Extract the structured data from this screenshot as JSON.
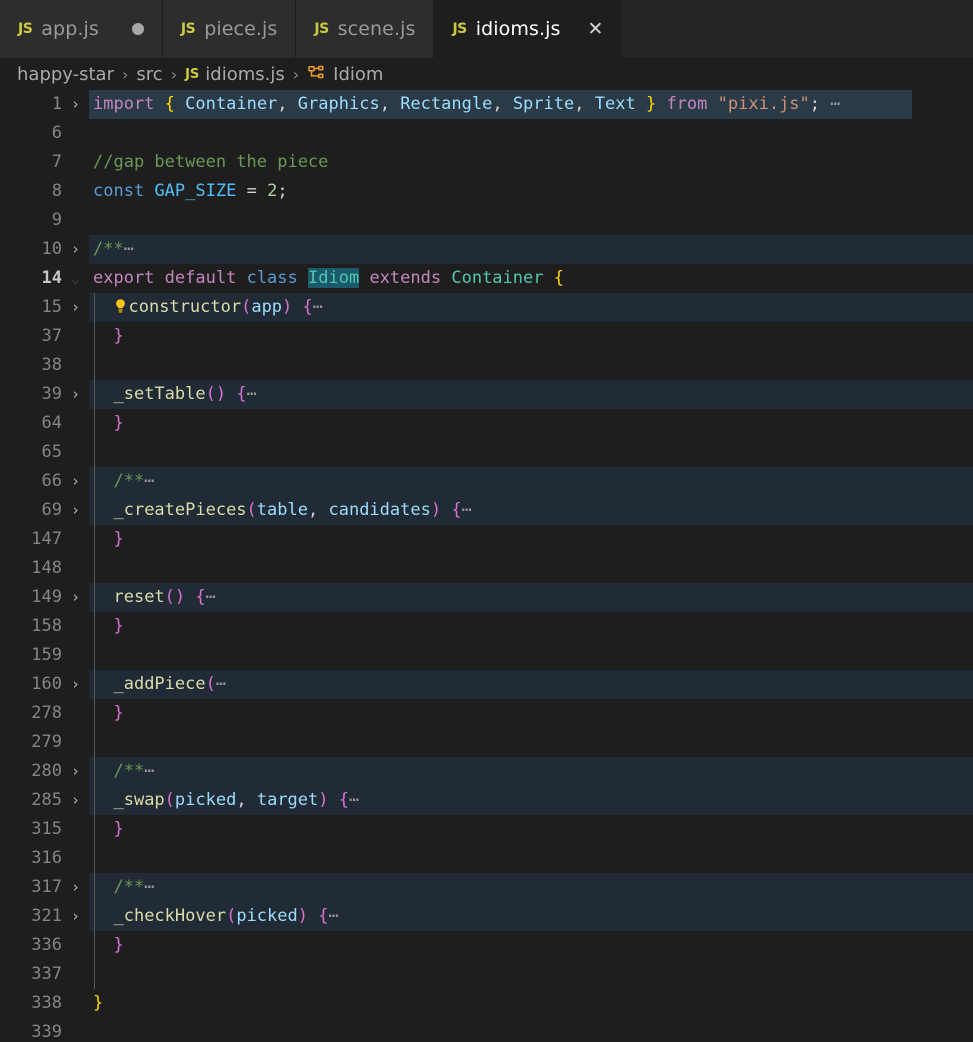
{
  "window": {
    "app": "vscode",
    "colors": {
      "editor_bg": "#1e1e1e",
      "tabbar_bg": "#252526",
      "tab_inactive_bg": "#2d2d2d",
      "folded_region_bg": "#202b36",
      "selection_bg": "#1a5a6b",
      "js_icon": "#cbcb41",
      "class_icon": "#ee9d28"
    }
  },
  "tabs": [
    {
      "label": "app.js",
      "icon": "js-file-icon",
      "active": false,
      "dirty": true,
      "closable": false
    },
    {
      "label": "piece.js",
      "icon": "js-file-icon",
      "active": false,
      "dirty": false,
      "closable": false
    },
    {
      "label": "scene.js",
      "icon": "js-file-icon",
      "active": false,
      "dirty": false,
      "closable": false
    },
    {
      "label": "idioms.js",
      "icon": "js-file-icon",
      "active": true,
      "dirty": false,
      "closable": true,
      "close_label": "✕"
    }
  ],
  "breadcrumb": {
    "separator": "›",
    "items": [
      {
        "label": "happy-star",
        "icon": null
      },
      {
        "label": "src",
        "icon": null
      },
      {
        "label": "idioms.js",
        "icon": "js-file-icon"
      },
      {
        "label": "Idiom",
        "icon": "class-symbol-icon"
      }
    ]
  },
  "editor": {
    "file": "idioms.js",
    "language": "javascript",
    "current_line": 14,
    "lines": [
      {
        "num": "1",
        "fold": "collapsed",
        "state": "selected",
        "indent": 0,
        "tokens": [
          {
            "t": "import",
            "c": "t-key"
          },
          {
            "t": " ",
            "c": "t-plain"
          },
          {
            "t": "{",
            "c": "t-br1"
          },
          {
            "t": " ",
            "c": "t-plain"
          },
          {
            "t": "Container",
            "c": "t-var"
          },
          {
            "t": ",",
            "c": "t-plain"
          },
          {
            "t": " ",
            "c": "t-plain"
          },
          {
            "t": "Graphics",
            "c": "t-var"
          },
          {
            "t": ",",
            "c": "t-plain"
          },
          {
            "t": " ",
            "c": "t-plain"
          },
          {
            "t": "Rectangle",
            "c": "t-var"
          },
          {
            "t": ",",
            "c": "t-plain"
          },
          {
            "t": " ",
            "c": "t-plain"
          },
          {
            "t": "Sprite",
            "c": "t-var"
          },
          {
            "t": ",",
            "c": "t-plain"
          },
          {
            "t": " ",
            "c": "t-plain"
          },
          {
            "t": "Text",
            "c": "t-var"
          },
          {
            "t": " ",
            "c": "t-plain"
          },
          {
            "t": "}",
            "c": "t-br1"
          },
          {
            "t": " ",
            "c": "t-plain"
          },
          {
            "t": "from",
            "c": "t-key"
          },
          {
            "t": " ",
            "c": "t-plain"
          },
          {
            "t": "\"pixi.js\"",
            "c": "t-str"
          },
          {
            "t": ";",
            "c": "t-plain"
          },
          {
            "t": " ⋯",
            "c": "t-ell"
          }
        ]
      },
      {
        "num": "6",
        "fold": "none",
        "state": "normal",
        "indent": 0,
        "tokens": []
      },
      {
        "num": "7",
        "fold": "none",
        "state": "normal",
        "indent": 0,
        "tokens": [
          {
            "t": "//gap between the piece",
            "c": "t-com"
          }
        ]
      },
      {
        "num": "8",
        "fold": "none",
        "state": "normal",
        "indent": 0,
        "tokens": [
          {
            "t": "const",
            "c": "t-kw2"
          },
          {
            "t": " ",
            "c": "t-plain"
          },
          {
            "t": "GAP_SIZE",
            "c": "t-ctrl"
          },
          {
            "t": " ",
            "c": "t-plain"
          },
          {
            "t": "=",
            "c": "t-plain"
          },
          {
            "t": " ",
            "c": "t-plain"
          },
          {
            "t": "2",
            "c": "t-num"
          },
          {
            "t": ";",
            "c": "t-plain"
          }
        ]
      },
      {
        "num": "9",
        "fold": "none",
        "state": "normal",
        "indent": 0,
        "tokens": []
      },
      {
        "num": "10",
        "fold": "collapsed",
        "state": "folded",
        "indent": 0,
        "tokens": [
          {
            "t": "/**",
            "c": "t-com"
          },
          {
            "t": "⋯",
            "c": "t-ell"
          }
        ]
      },
      {
        "num": "14",
        "fold": "expanded",
        "state": "current",
        "indent": 0,
        "tokens": [
          {
            "t": "export",
            "c": "t-key"
          },
          {
            "t": " ",
            "c": "t-plain"
          },
          {
            "t": "default",
            "c": "t-key"
          },
          {
            "t": " ",
            "c": "t-plain"
          },
          {
            "t": "class",
            "c": "t-kw2"
          },
          {
            "t": " ",
            "c": "t-plain"
          },
          {
            "t": "Idiom",
            "c": "t-hl"
          },
          {
            "t": " ",
            "c": "t-plain"
          },
          {
            "t": "extends",
            "c": "t-key"
          },
          {
            "t": " ",
            "c": "t-plain"
          },
          {
            "t": "Container",
            "c": "t-cls"
          },
          {
            "t": " ",
            "c": "t-plain"
          },
          {
            "t": "{",
            "c": "t-br1"
          }
        ]
      },
      {
        "num": "15",
        "fold": "collapsed",
        "state": "folded",
        "indent": 1,
        "bulb": true,
        "tokens": [
          {
            "t": "constructor",
            "c": "t-fn"
          },
          {
            "t": "(",
            "c": "t-br2"
          },
          {
            "t": "app",
            "c": "t-var"
          },
          {
            "t": ")",
            "c": "t-br2"
          },
          {
            "t": " ",
            "c": "t-plain"
          },
          {
            "t": "{",
            "c": "t-br2"
          },
          {
            "t": "⋯",
            "c": "t-ell"
          }
        ]
      },
      {
        "num": "37",
        "fold": "none",
        "state": "normal",
        "indent": 1,
        "tokens": [
          {
            "t": "}",
            "c": "t-br2"
          }
        ]
      },
      {
        "num": "38",
        "fold": "none",
        "state": "normal",
        "indent": 1,
        "tokens": []
      },
      {
        "num": "39",
        "fold": "collapsed",
        "state": "folded",
        "indent": 1,
        "tokens": [
          {
            "t": "_setTable",
            "c": "t-fn"
          },
          {
            "t": "()",
            "c": "t-br2"
          },
          {
            "t": " ",
            "c": "t-plain"
          },
          {
            "t": "{",
            "c": "t-br2"
          },
          {
            "t": "⋯",
            "c": "t-ell"
          }
        ]
      },
      {
        "num": "64",
        "fold": "none",
        "state": "normal",
        "indent": 1,
        "tokens": [
          {
            "t": "}",
            "c": "t-br2"
          }
        ]
      },
      {
        "num": "65",
        "fold": "none",
        "state": "normal",
        "indent": 1,
        "tokens": []
      },
      {
        "num": "66",
        "fold": "collapsed",
        "state": "folded",
        "indent": 1,
        "tokens": [
          {
            "t": "/**",
            "c": "t-com"
          },
          {
            "t": "⋯",
            "c": "t-ell"
          }
        ]
      },
      {
        "num": "69",
        "fold": "collapsed",
        "state": "folded",
        "indent": 1,
        "tokens": [
          {
            "t": "_createPieces",
            "c": "t-fn"
          },
          {
            "t": "(",
            "c": "t-br2"
          },
          {
            "t": "table",
            "c": "t-var"
          },
          {
            "t": ",",
            "c": "t-plain"
          },
          {
            "t": " ",
            "c": "t-plain"
          },
          {
            "t": "candidates",
            "c": "t-var"
          },
          {
            "t": ")",
            "c": "t-br2"
          },
          {
            "t": " ",
            "c": "t-plain"
          },
          {
            "t": "{",
            "c": "t-br2"
          },
          {
            "t": "⋯",
            "c": "t-ell"
          }
        ]
      },
      {
        "num": "147",
        "fold": "none",
        "state": "normal",
        "indent": 1,
        "tokens": [
          {
            "t": "}",
            "c": "t-br2"
          }
        ]
      },
      {
        "num": "148",
        "fold": "none",
        "state": "normal",
        "indent": 1,
        "tokens": []
      },
      {
        "num": "149",
        "fold": "collapsed",
        "state": "folded",
        "indent": 1,
        "tokens": [
          {
            "t": "reset",
            "c": "t-fn"
          },
          {
            "t": "()",
            "c": "t-br2"
          },
          {
            "t": " ",
            "c": "t-plain"
          },
          {
            "t": "{",
            "c": "t-br2"
          },
          {
            "t": "⋯",
            "c": "t-ell"
          }
        ]
      },
      {
        "num": "158",
        "fold": "none",
        "state": "normal",
        "indent": 1,
        "tokens": [
          {
            "t": "}",
            "c": "t-br2"
          }
        ]
      },
      {
        "num": "159",
        "fold": "none",
        "state": "normal",
        "indent": 1,
        "tokens": []
      },
      {
        "num": "160",
        "fold": "collapsed",
        "state": "folded",
        "indent": 1,
        "tokens": [
          {
            "t": "_addPiece",
            "c": "t-fn"
          },
          {
            "t": "(",
            "c": "t-br2"
          },
          {
            "t": "⋯",
            "c": "t-ell"
          }
        ]
      },
      {
        "num": "278",
        "fold": "none",
        "state": "normal",
        "indent": 1,
        "tokens": [
          {
            "t": "}",
            "c": "t-br2"
          }
        ]
      },
      {
        "num": "279",
        "fold": "none",
        "state": "normal",
        "indent": 1,
        "tokens": []
      },
      {
        "num": "280",
        "fold": "collapsed",
        "state": "folded",
        "indent": 1,
        "tokens": [
          {
            "t": "/**",
            "c": "t-com"
          },
          {
            "t": "⋯",
            "c": "t-ell"
          }
        ]
      },
      {
        "num": "285",
        "fold": "collapsed",
        "state": "folded",
        "indent": 1,
        "tokens": [
          {
            "t": "_swap",
            "c": "t-fn"
          },
          {
            "t": "(",
            "c": "t-br2"
          },
          {
            "t": "picked",
            "c": "t-var"
          },
          {
            "t": ",",
            "c": "t-plain"
          },
          {
            "t": " ",
            "c": "t-plain"
          },
          {
            "t": "target",
            "c": "t-var"
          },
          {
            "t": ")",
            "c": "t-br2"
          },
          {
            "t": " ",
            "c": "t-plain"
          },
          {
            "t": "{",
            "c": "t-br2"
          },
          {
            "t": "⋯",
            "c": "t-ell"
          }
        ]
      },
      {
        "num": "315",
        "fold": "none",
        "state": "normal",
        "indent": 1,
        "tokens": [
          {
            "t": "}",
            "c": "t-br2"
          }
        ]
      },
      {
        "num": "316",
        "fold": "none",
        "state": "normal",
        "indent": 1,
        "tokens": []
      },
      {
        "num": "317",
        "fold": "collapsed",
        "state": "folded",
        "indent": 1,
        "tokens": [
          {
            "t": "/**",
            "c": "t-com"
          },
          {
            "t": "⋯",
            "c": "t-ell"
          }
        ]
      },
      {
        "num": "321",
        "fold": "collapsed",
        "state": "folded",
        "indent": 1,
        "tokens": [
          {
            "t": "_checkHover",
            "c": "t-fn"
          },
          {
            "t": "(",
            "c": "t-br2"
          },
          {
            "t": "picked",
            "c": "t-var"
          },
          {
            "t": ")",
            "c": "t-br2"
          },
          {
            "t": " ",
            "c": "t-plain"
          },
          {
            "t": "{",
            "c": "t-br2"
          },
          {
            "t": "⋯",
            "c": "t-ell"
          }
        ]
      },
      {
        "num": "336",
        "fold": "none",
        "state": "normal",
        "indent": 1,
        "tokens": [
          {
            "t": "}",
            "c": "t-br2"
          }
        ]
      },
      {
        "num": "337",
        "fold": "none",
        "state": "normal",
        "indent": 1,
        "tokens": []
      },
      {
        "num": "338",
        "fold": "none",
        "state": "normal",
        "indent": 0,
        "tokens": [
          {
            "t": "}",
            "c": "t-br1"
          }
        ]
      },
      {
        "num": "339",
        "fold": "none",
        "state": "normal",
        "indent": 0,
        "tokens": []
      }
    ],
    "glyphs": {
      "fold_collapsed": "›",
      "fold_expanded": "⌄",
      "lightbulb": "lightbulb-icon"
    }
  }
}
